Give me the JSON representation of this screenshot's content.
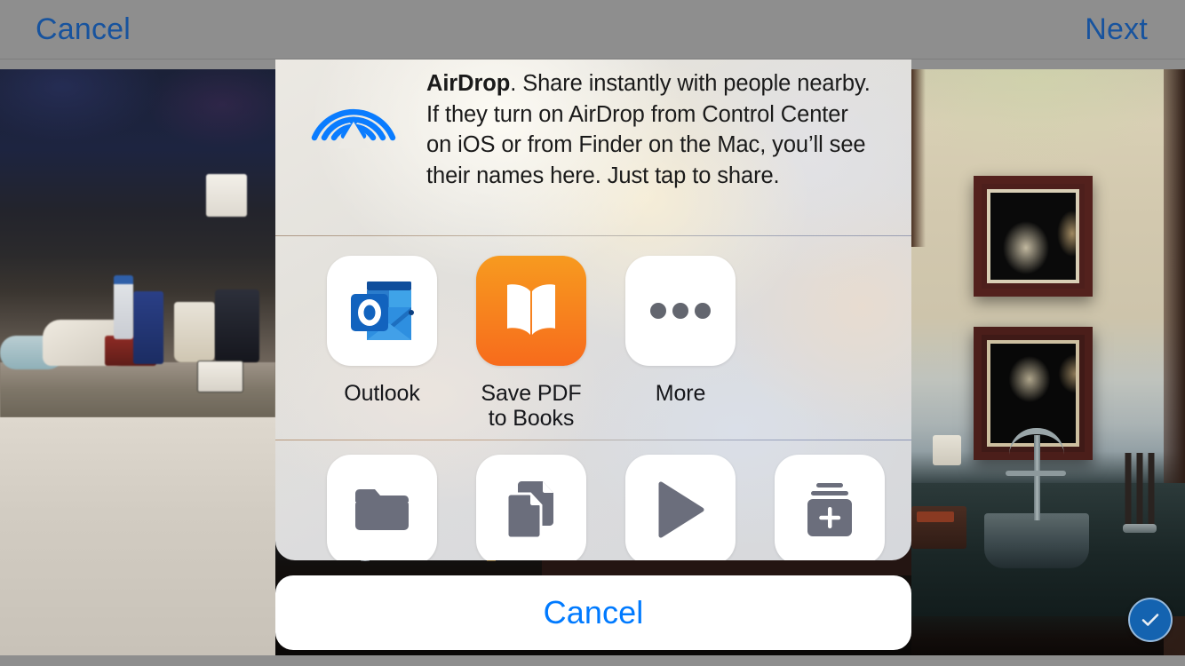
{
  "topbar": {
    "cancel_label": "Cancel",
    "next_label": "Next",
    "link_color": "#17539e"
  },
  "share_sheet": {
    "airdrop": {
      "icon": "airdrop-icon",
      "icon_color": "#0a7cff",
      "title": "AirDrop",
      "body": ". Share instantly with people nearby. If they turn on AirDrop from Control Center on iOS or from Finder on the Mac, you’ll see their names here. Just tap to share."
    },
    "apps": [
      {
        "label": "Outlook",
        "icon": "outlook-icon",
        "tile_style": "white"
      },
      {
        "label": "Save PDF\nto Books",
        "label_line1": "Save PDF",
        "label_line2": "to Books",
        "icon": "books-icon",
        "tile_style": "orange",
        "tile_color": "#f7811e"
      },
      {
        "label": "More",
        "icon": "ellipsis-icon",
        "tile_style": "white"
      }
    ],
    "actions": [
      {
        "name": "save-to-files-action",
        "icon": "folder-icon"
      },
      {
        "name": "duplicate-action",
        "icon": "documents-copy-icon"
      },
      {
        "name": "slideshow-action",
        "icon": "play-icon"
      },
      {
        "name": "add-to-album-action",
        "icon": "add-to-album-icon"
      },
      {
        "name": "more-actions",
        "icon": "partial-icon"
      }
    ],
    "action_icon_color": "#6b6e7c"
  },
  "cancel_button": {
    "label": "Cancel",
    "color": "#007aff"
  },
  "photo_selection": {
    "badge_icon": "checkmark-icon",
    "badge_color": "#1463b0"
  }
}
